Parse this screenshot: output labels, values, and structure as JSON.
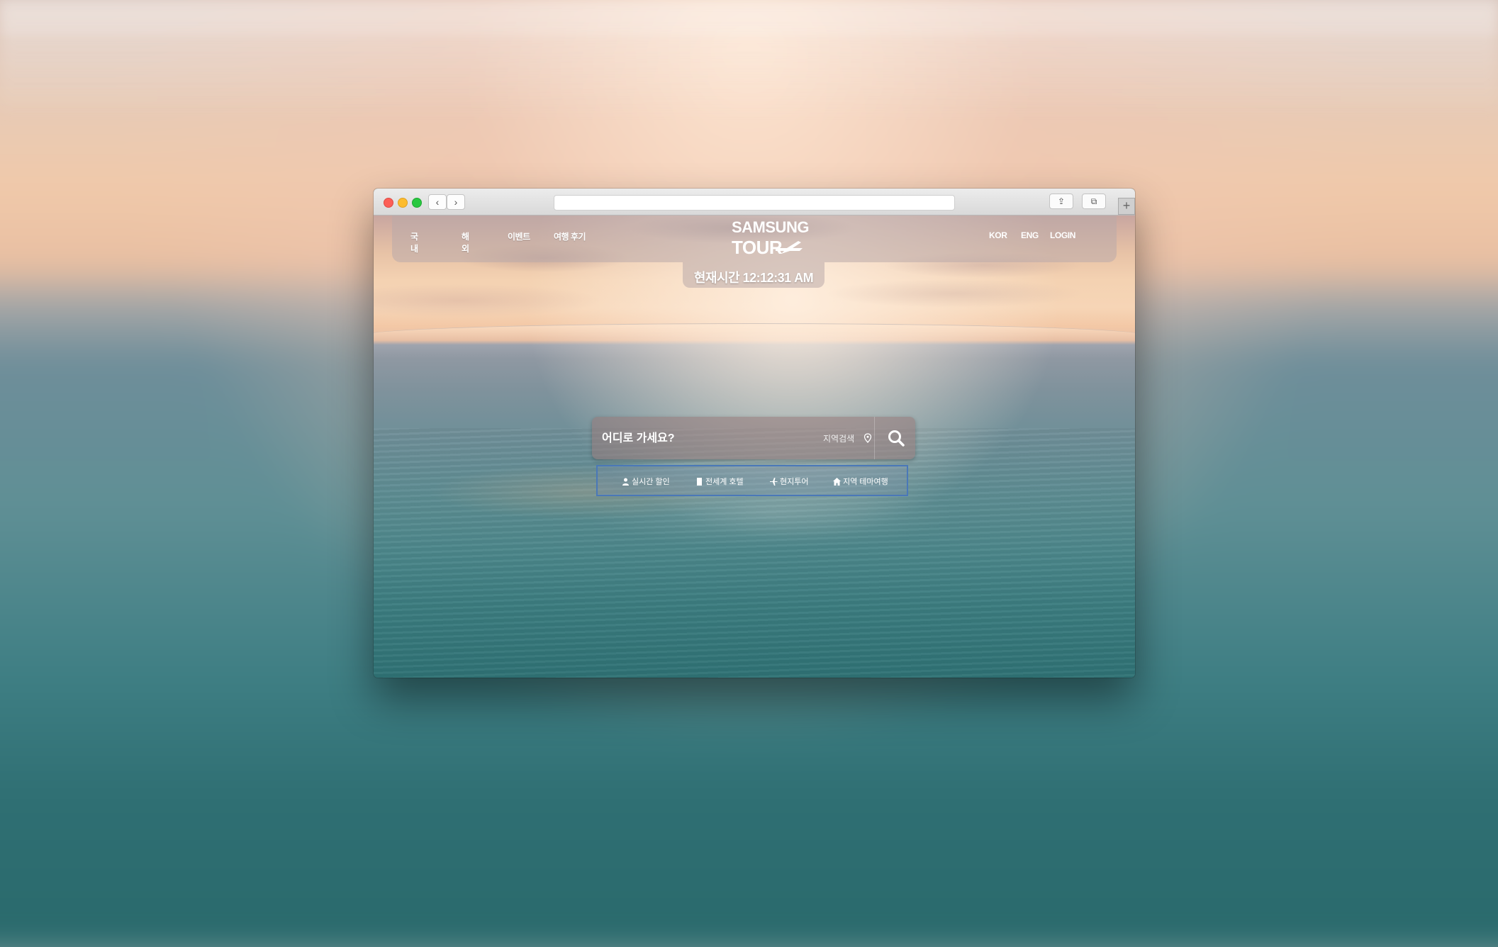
{
  "window": {
    "nav_back_symbol": "‹",
    "nav_forward_symbol": "›",
    "share_symbol": "⇪",
    "tabs_symbol": "⧉",
    "new_tab_symbol": "+"
  },
  "header": {
    "nav": [
      {
        "label": "국내"
      },
      {
        "label": "해외"
      },
      {
        "label": "이벤트"
      },
      {
        "label": "여행 후기"
      }
    ],
    "logo_line1": "SAMSUNG",
    "logo_line2": "TOUR",
    "lang_kor": "KOR",
    "lang_eng": "ENG",
    "login": "LOGIN"
  },
  "clock": {
    "text": "현재시간 12:12:31 AM"
  },
  "search": {
    "placeholder": "어디로 가세요?",
    "region_label": "지역검색"
  },
  "quick_links": [
    {
      "label": "실시간 할인",
      "icon": "person-icon"
    },
    {
      "label": "전세계 호텔",
      "icon": "building-icon"
    },
    {
      "label": "현지투어",
      "icon": "plane-icon"
    },
    {
      "label": "지역 테마여행",
      "icon": "home-icon"
    }
  ],
  "colors": {
    "quick_border": "#4a78b8",
    "traffic_red": "#fc5f57",
    "traffic_yellow": "#fdbc2e",
    "traffic_green": "#28c840"
  }
}
